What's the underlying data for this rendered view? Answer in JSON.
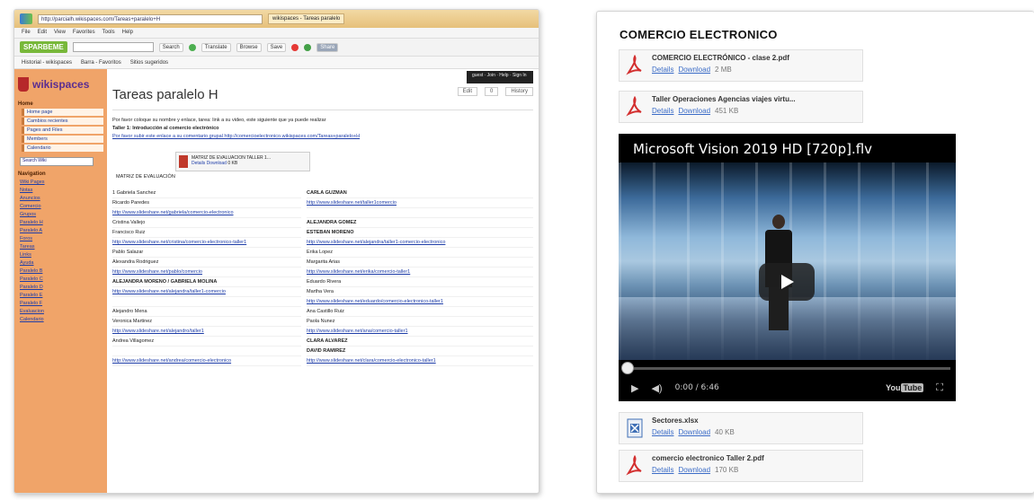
{
  "left_browser": {
    "address_text": "http://parcialh.wikispaces.com/Tareas+paralelo+H",
    "tab_label": "wikispaces - Tareas paralelo",
    "menu": [
      "File",
      "Edit",
      "View",
      "Favorites",
      "Tools",
      "Help"
    ],
    "toolbar_brand": "SPARBEME",
    "toolbar_buttons": [
      "Search",
      "Translate",
      "Browse",
      "Save",
      "Share"
    ],
    "bookmarks": [
      "Historial - wikispaces",
      "Barra - Favoritos",
      "Sitios sugeridos"
    ],
    "wiki_brand": "wikispaces",
    "sidebar": {
      "section_1": "Home",
      "section_1_items": [
        "Home page",
        "Cambios recientes",
        "Pages and Files",
        "Members",
        "Calendario"
      ],
      "search_placeholder": "Search Wiki",
      "section_2": "Navigation",
      "links": [
        "Wiki Pages",
        "Notas",
        "Anuncios",
        "Comercio",
        "Grupos",
        "Paralelo H",
        "Paralelo A",
        "Foros",
        "Tareas",
        "Links",
        "Ayuda",
        "Paralelo B",
        "Paralelo C",
        "Paralelo D",
        "Paralelo E",
        "Paralelo F",
        "Evaluacion",
        "Calendario"
      ]
    },
    "topbar_text": "guest · Join · Help · Sign In",
    "page_title": "Tareas paralelo H",
    "actions": [
      "Edit",
      "0",
      "History"
    ],
    "intro_lines": [
      "Por favor coloque su nombre y enlace, tarea: link a su video, este siguiente que ya puede realizar",
      "Taller 1: Introducción al comercio electrónico",
      "Por favor subir este enlace a su comentario grupal http://comercioelectronico.wikispaces.com/Tareas+paralelo+H"
    ],
    "attachment": {
      "name": "MATRIZ DE EVALUACION TALLER 1...",
      "links": [
        "Details",
        "Download",
        "0 KB"
      ],
      "caption": "MATRIZ DE EVALUACIÓN"
    },
    "grid_rows": [
      [
        "1 Gabriela Sanchez",
        "CARLA GUZMAN"
      ],
      [
        "Ricardo Paredes",
        "http://www.slideshare.net/taller1comercio"
      ],
      [
        "http://www.slideshare.net/gabriela/comercio-electronico",
        ""
      ],
      [
        "Cristina Vallejo",
        "ALEJANDRA GOMEZ"
      ],
      [
        "Francisco Ruiz",
        "ESTEBAN MORENO"
      ],
      [
        "http://www.slideshare.net/cristina/comercio-electronico-taller1",
        "http://www.slideshare.net/alejandra/taller1-comercio-electronico"
      ],
      [
        "Pablo Salazar",
        "Erika Lopez"
      ],
      [
        "Alexandra Rodriguez",
        "Margarita Arias"
      ],
      [
        "http://www.slideshare.net/pablo/comercio",
        "http://www.slideshare.net/erika/comercio-taller1"
      ],
      [
        "ALEJANDRA MORENO / GABRIELA MOLINA",
        "Eduardo Rivera"
      ],
      [
        "http://www.slideshare.net/alejandra/taller1-comercio",
        "Martha Vera"
      ],
      [
        "",
        "http://www.slideshare.net/eduardo/comercio-electronico-taller1"
      ],
      [
        "Alejandro Mena",
        "Ana Castillo Ruiz"
      ],
      [
        "Veronica Martinez",
        "Paola Nunez"
      ],
      [
        "http://www.slideshare.net/alejandro/taller1",
        "http://www.slideshare.net/ana/comercio-taller1"
      ],
      [
        "Andrea Villagomez",
        "CLARA ALVAREZ"
      ],
      [
        "",
        "DAVID RAMIREZ"
      ],
      [
        "http://www.slideshare.net/andrea/comercio-electronico",
        "http://www.slideshare.net/clara/comercio-electronico-taller1"
      ]
    ]
  },
  "right_panel": {
    "title": "COMERCIO ELECTRONICO",
    "files": [
      {
        "name": "COMERCIO ELECTRÓNICO - clase 2.pdf",
        "details": "Details",
        "download": "Download",
        "size": "2 MB",
        "icon": "pdf-icon"
      },
      {
        "name": "Taller Operaciones Agencias viajes virtu...",
        "details": "Details",
        "download": "Download",
        "size": "451 KB",
        "icon": "pdf-icon"
      },
      {
        "name": "Sectores.xlsx",
        "details": "Details",
        "download": "Download",
        "size": "40 KB",
        "icon": "spreadsheet-icon"
      },
      {
        "name": "comercio electronico Taller 2.pdf",
        "details": "Details",
        "download": "Download",
        "size": "170 KB",
        "icon": "pdf-icon"
      }
    ],
    "video": {
      "title": "Microsoft Vision  2019  HD [720p].flv",
      "time": "0:00 / 6:46",
      "progress": 0,
      "brand": "You",
      "brand_box": "Tube"
    }
  }
}
